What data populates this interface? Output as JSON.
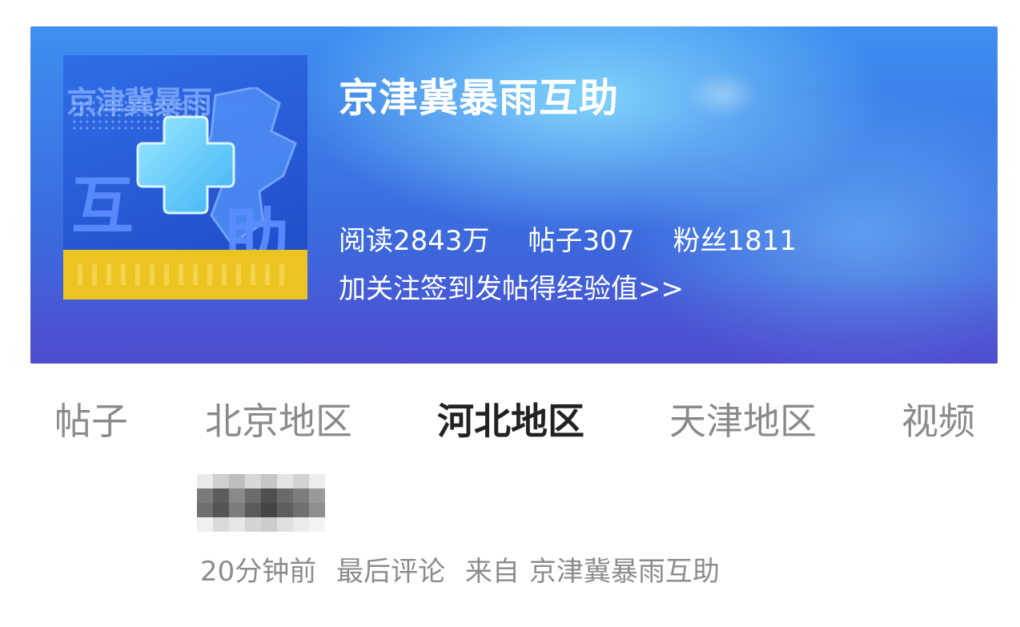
{
  "topic": {
    "title": "京津冀暴雨互助",
    "stats": {
      "reads": "阅读2843万",
      "posts": "帖子307",
      "fans": "粉丝1811"
    },
    "promo_link": "加关注签到发帖得经验值>>",
    "logo": {
      "stamp_text": "京津冀暴雨",
      "chars": [
        "互",
        "助"
      ],
      "icon": "plus-cross-icon"
    }
  },
  "tabs": [
    {
      "label": "帖子",
      "active": false
    },
    {
      "label": "北京地区",
      "active": false
    },
    {
      "label": "河北地区",
      "active": true
    },
    {
      "label": "天津地区",
      "active": false
    },
    {
      "label": "视频",
      "active": false
    }
  ],
  "post": {
    "author": "",
    "time": "20分钟前",
    "last_comment": "最后评论",
    "from_label": "来自",
    "source": "京津冀暴雨互助"
  },
  "colors": {
    "banner_top": "#3f8ff0",
    "banner_bottom": "#4a52cf",
    "logo_yellow": "#ecc421",
    "tab_active": "#222222",
    "tab_inactive": "#8a8a8a",
    "meta_text": "#8c8c8c"
  }
}
